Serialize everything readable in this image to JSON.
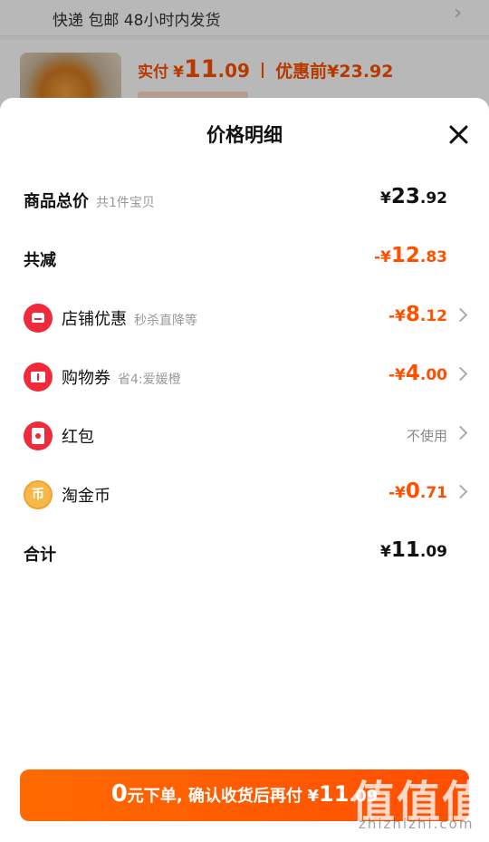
{
  "background": {
    "shipping_text": "快递 包邮 48小时内发货",
    "price_label": "实付",
    "price_currency": "¥",
    "price_int": "11",
    "price_dec": ".09",
    "before_label": "优惠前",
    "before_price": "¥23.92"
  },
  "sheet": {
    "title": "价格明细",
    "rows": {
      "total": {
        "label": "商品总价",
        "sub": "共1件宝贝",
        "yen": "¥",
        "int": "23",
        "dec": ".92"
      },
      "reduced": {
        "label": "共减",
        "yen": "-¥",
        "int": "12",
        "dec": ".83"
      },
      "shop": {
        "label": "店铺优惠",
        "sub": "秒杀直降等",
        "yen": "-¥",
        "int": "8",
        "dec": ".12",
        "icon": "shop-icon"
      },
      "coupon": {
        "label": "购物券",
        "sub": "省4:爱媛橙",
        "yen": "-¥",
        "int": "4",
        "dec": ".00",
        "icon": "ticket-icon"
      },
      "redpacket": {
        "label": "红包",
        "status": "不使用",
        "icon": "red-envelope-icon"
      },
      "coin": {
        "label": "淘金币",
        "yen": "-¥",
        "int": "0",
        "dec": ".71",
        "icon": "coin-icon",
        "coin_glyph": "币"
      },
      "sum": {
        "label": "合计",
        "yen": "¥",
        "int": "11",
        "dec": ".09"
      }
    }
  },
  "order_button": {
    "zero": "0",
    "text": "元下单, 确认收货后再付",
    "yen": "¥",
    "int": "11",
    "dec": ".09"
  },
  "watermark": {
    "main": "值值值",
    "sub": "zhizhizhi.com"
  },
  "colors": {
    "accent": "#ff5000",
    "icon_red": "#f02a3a",
    "coin": "#f7b84a"
  }
}
